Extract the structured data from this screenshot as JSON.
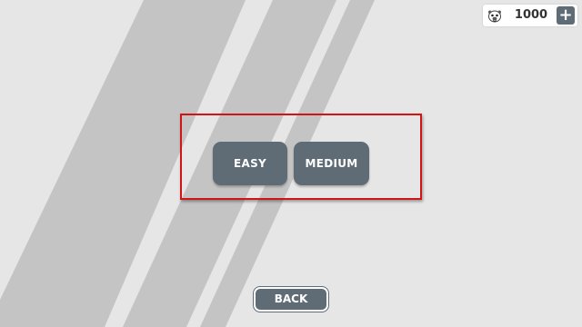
{
  "coins": {
    "value": "1000",
    "add_label": "+",
    "icon": "pug-dog-head-icon"
  },
  "difficulty": {
    "easy_label": "EASY",
    "medium_label": "MEDIUM"
  },
  "navigation": {
    "back_label": "BACK"
  },
  "colors": {
    "background": "#e6e6e6",
    "stripe": "#c4c4c4",
    "button": "#5f6b75",
    "highlight": "#d21414"
  }
}
